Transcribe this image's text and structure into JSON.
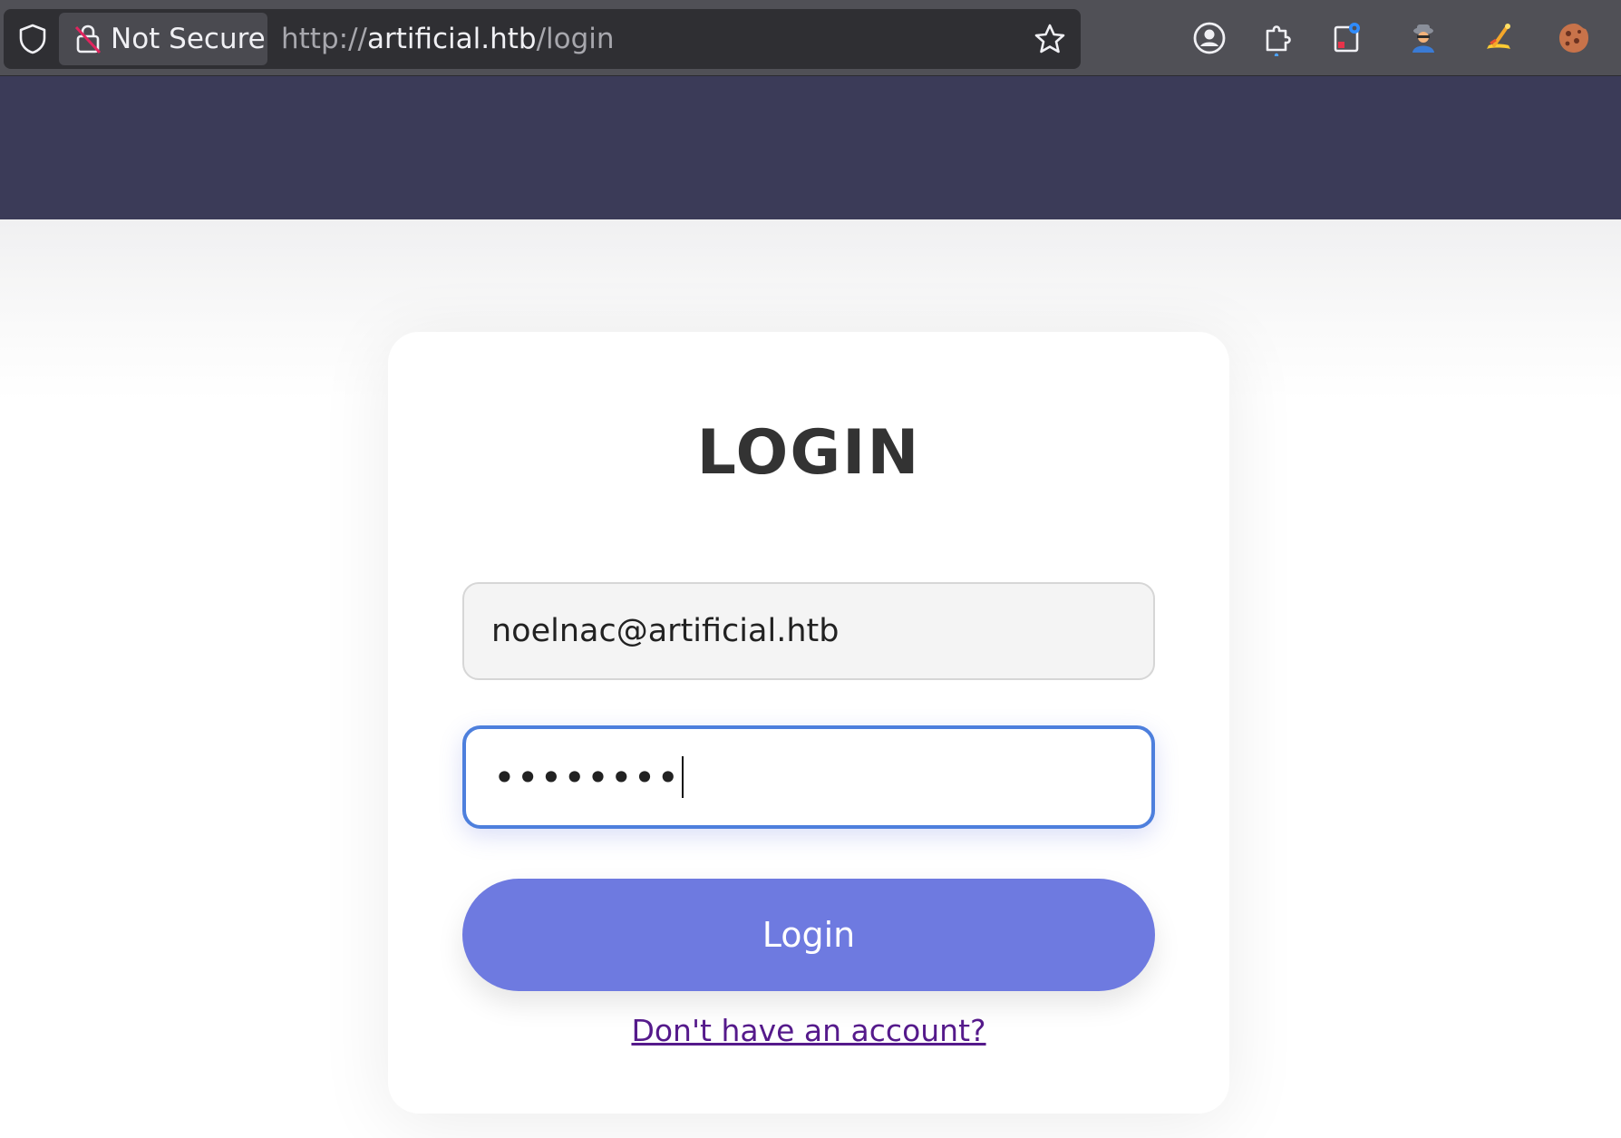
{
  "browser": {
    "security_label": "Not Secure",
    "url": {
      "scheme": "http://",
      "host": "artificial.htb",
      "path": "/login"
    },
    "toolbar_icons": [
      "account-icon",
      "extensions-puzzle-icon",
      "screenshot-tab-icon",
      "spy-agent-extension-icon",
      "wand-extension-icon",
      "cookie-extension-icon"
    ]
  },
  "login": {
    "title": "LOGIN",
    "email_value": "noelnac@artificial.htb",
    "password_mask": "••••••••",
    "submit_label": "Login",
    "signup_link": "Don't have an account?"
  },
  "colors": {
    "header": "#3b3b58",
    "button": "#6e7ae0",
    "focus_ring": "#4d7fdd",
    "link_visited": "#551a8b"
  }
}
